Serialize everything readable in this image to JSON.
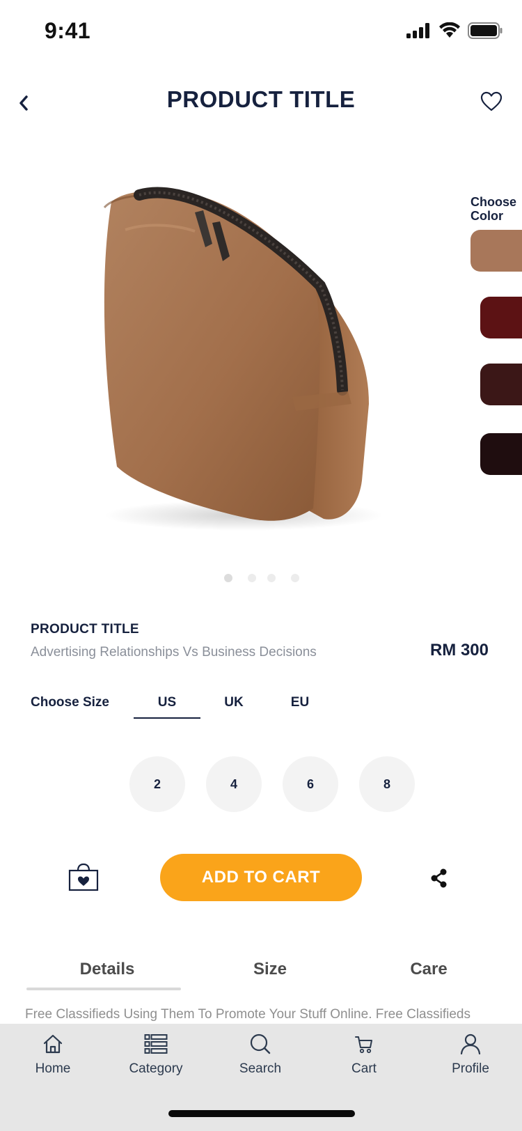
{
  "status_bar": {
    "time": "9:41"
  },
  "header": {
    "title": "PRODUCT TITLE"
  },
  "colors": {
    "label": "Choose\nColor",
    "swatches": [
      "#a8775a",
      "#5c1214",
      "#3b1717",
      "#1f0d0f"
    ]
  },
  "gallery": {
    "dot_count": 4,
    "active_index": 0
  },
  "product": {
    "title": "PRODUCT TITLE",
    "subtitle": "Advertising Relationships Vs Business Decisions",
    "price": "RM 300"
  },
  "size": {
    "label": "Choose Size",
    "tabs": [
      "US",
      "UK",
      "EU"
    ],
    "selected_tab": "US",
    "options": [
      "2",
      "4",
      "6",
      "8"
    ]
  },
  "actions": {
    "add_to_cart": "ADD TO CART",
    "accent": "#faa41a"
  },
  "info_tabs": {
    "items": [
      "Details",
      "Size",
      "Care"
    ],
    "selected": "Details",
    "description": "Free Classifieds Using Them To Promote Your Stuff Online. Free Classifieds"
  },
  "nav": {
    "items": [
      {
        "label": "Home",
        "icon": "home-icon"
      },
      {
        "label": "Category",
        "icon": "category-icon"
      },
      {
        "label": "Search",
        "icon": "search-icon"
      },
      {
        "label": "Cart",
        "icon": "cart-icon"
      },
      {
        "label": "Profile",
        "icon": "profile-icon"
      }
    ]
  }
}
